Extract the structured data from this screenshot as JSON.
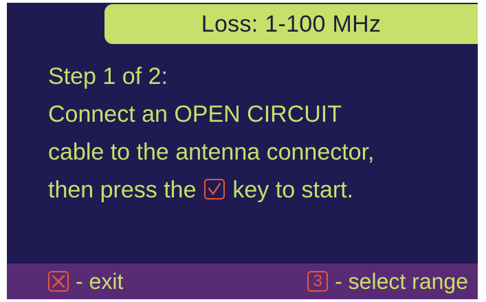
{
  "header": {
    "title": "Loss: 1-100 MHz"
  },
  "instructions": {
    "step": "Step 1 of 2:",
    "line1": "Connect an OPEN CIRCUIT",
    "line2": "cable to the antenna connector,",
    "line3_before": "then press the",
    "line3_after": "key to start."
  },
  "footer": {
    "exit_key_icon": "x-box-icon",
    "exit_label": "- exit",
    "range_key_digit": "3",
    "range_label": "- select range"
  },
  "colors": {
    "background": "#1f1a52",
    "accent": "#c6e06a",
    "footer": "#5a2b75",
    "key_icon": "#e8553a"
  }
}
